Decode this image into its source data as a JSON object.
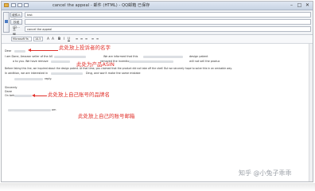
{
  "window": {
    "title": "cancel the appeal - 邮件 (HTML) - QQ邮箱 已保存",
    "buttons": {
      "minimize": "–",
      "maximize": "□",
      "close": "✕"
    }
  },
  "headers": {
    "send_label": "发送",
    "to_label": "收件人(I)...",
    "to_value": "test",
    "cc_label": "抄送(C)...",
    "cc_value": "",
    "subject_label": "主题(U):",
    "subject_value": "cancel the appeal"
  },
  "toolbar": {
    "font": "Microsoft Ya",
    "size": "10.5",
    "buttons": [
      "A",
      "A",
      "B",
      "I",
      "U",
      "≡",
      "≡",
      "≡",
      "≡",
      "≡"
    ]
  },
  "body": {
    "greeting": "Dear",
    "line1": "I am Dane, Amazon seller of the AS",
    "line1b": "We are informed that this",
    "line1c": "design patent",
    "line2": "a to you. We have remove",
    "line2b": "removed the invention",
    "line2c": "will not sell the produc",
    "line3": "Before listing this line, we inquired about the design patent. At that time, you claimed that the product did not take off the shelf. But we sincerely hope to solve this in an amicable way.",
    "line4": "In addition, we are interested in",
    "line4b": "Ding, and won't make the same mistake",
    "line5": "reply.",
    "sign1": "Sincerely",
    "sign2": "Dane",
    "sign3": "On beh",
    "email": "om"
  },
  "annotations": {
    "complainant_name": "此处放上投诉者的名字",
    "asin": "此处为产品ASIN",
    "brand_name": "此处放上自己账号的品牌名",
    "email": "此处放上自己的账号邮箱"
  },
  "watermark": "知乎 @小兔子乖乖",
  "colors": {
    "annotation": "#e0302a",
    "title_bar": "#dfe7f2"
  }
}
